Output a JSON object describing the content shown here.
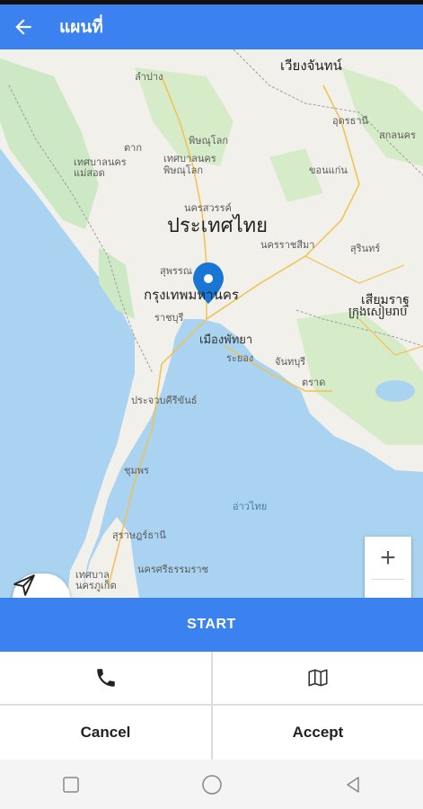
{
  "appbar": {
    "title": "แผนที่"
  },
  "map": {
    "labels": {
      "vientiane": "เวียงจันทน์",
      "lampang": "ลำปาง",
      "udon": "อุดรธานี",
      "sakon": "สกลนคร",
      "tak": "ตาก",
      "phitsanulok": "พิษณุโลก",
      "tessaban_maesot": "เทศบาลนคร แม่สอด",
      "tessaban_phitsanulok": "เทศบาลนคร พิษณุโลก",
      "khonkaen": "ขอนแก่น",
      "nakhonsawan": "นครสวรรค์",
      "thailand": "ประเทศไทย",
      "korat": "นครราชสีมา",
      "surin": "สุรินทร์",
      "suphan": "สุพรรณ",
      "bangkok": "กรุงเทพมหานคร",
      "siemreap": "เสียมราฐ",
      "siemreap_khmer": "ក្រុងសៀមរាប",
      "ratchaburi": "ราชบุรี",
      "pattaya": "เมืองพัทยา",
      "rayong": "ระยอง",
      "chanthaburi": "จันทบุรี",
      "trat": "ตราด",
      "prachuap": "ประจวบคีรีขันธ์",
      "chumphon": "ชุมพร",
      "gulf": "อ่าวไทย",
      "suratthani": "สุราษฎร์ธานี",
      "nakhonsi": "นครศรีธรรมราช",
      "phuket": "เทศบาล นครภูเก็ต"
    },
    "colors": {
      "water": "#a9d3f0",
      "land": "#f1f0ea",
      "green": "#cde8c4",
      "pin": "#1976d2"
    }
  },
  "controls": {
    "zoom_in": "+",
    "zoom_out": "−"
  },
  "start_label": "START",
  "actions": {
    "cancel": "Cancel",
    "accept": "Accept"
  },
  "icons": [
    "back-arrow-icon",
    "send-location-icon",
    "phone-icon",
    "map-icon",
    "square-nav-icon",
    "circle-nav-icon",
    "triangle-nav-icon"
  ],
  "theme": {
    "primary": "#3b82f0"
  }
}
